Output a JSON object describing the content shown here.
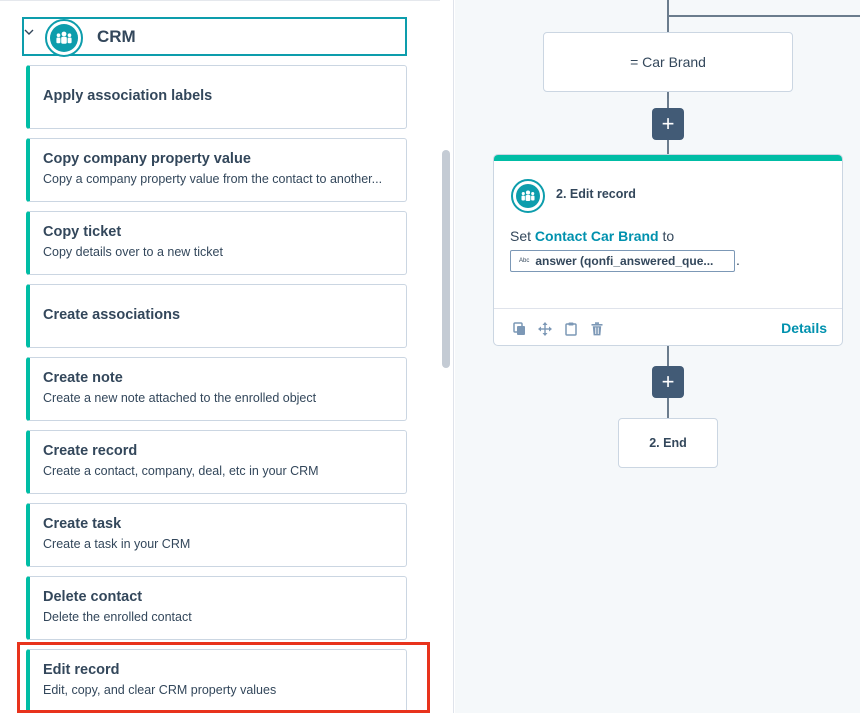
{
  "sidebar": {
    "category": {
      "title": "CRM",
      "icon": "people-icon",
      "expanded": true
    },
    "actions": [
      {
        "title": "Apply association labels",
        "description": ""
      },
      {
        "title": "Copy company property value",
        "description": "Copy a company property value from the contact to another..."
      },
      {
        "title": "Copy ticket",
        "description": "Copy details over to a new ticket"
      },
      {
        "title": "Create associations",
        "description": ""
      },
      {
        "title": "Create note",
        "description": "Create a new note attached to the enrolled object"
      },
      {
        "title": "Create record",
        "description": "Create a contact, company, deal, etc in your CRM"
      },
      {
        "title": "Create task",
        "description": "Create a task in your CRM"
      },
      {
        "title": "Delete contact",
        "description": "Delete the enrolled contact"
      },
      {
        "title": "Edit record",
        "description": "Edit, copy, and clear CRM property values"
      }
    ],
    "highlight_color": "#e8331c"
  },
  "canvas": {
    "branch": {
      "label": "= Car Brand"
    },
    "edit_action": {
      "title": "2. Edit record",
      "body_prefix": "Set ",
      "property": "Contact Car Brand",
      "body_suffix": " to",
      "token_type": "Abc",
      "token_value": "answer (qonfi_answered_que...",
      "token_end": ".",
      "details_label": "Details",
      "footer_icons": [
        "copy-icon",
        "move-icon",
        "clipboard-icon",
        "trash-icon"
      ]
    },
    "end": {
      "label": "2. End"
    },
    "plus_symbol": "+"
  },
  "colors": {
    "accent_teal": "#00bda5",
    "link": "#0091ae",
    "plus_button": "#425b76"
  }
}
